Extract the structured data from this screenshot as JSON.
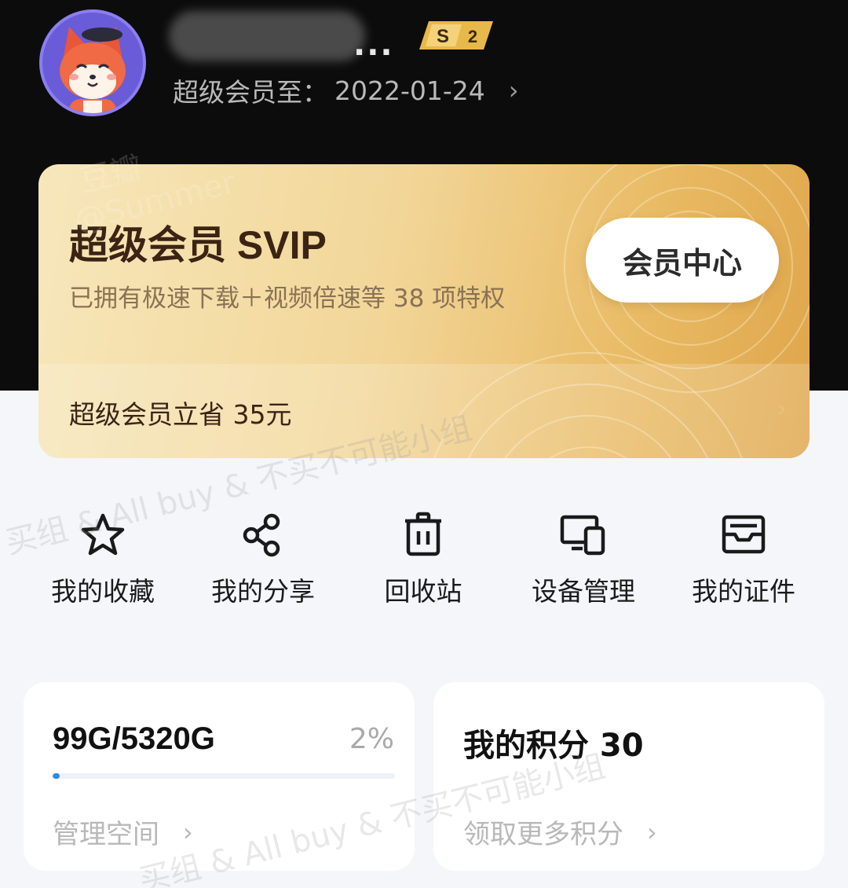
{
  "profile": {
    "username_suffix": "...",
    "level_badge_letter": "S",
    "level_badge_number": "2",
    "expiry_label": "超级会员至：",
    "expiry_date": "2022-01-24"
  },
  "svip_card": {
    "title": "超级会员 SVIP",
    "subtitle": "已拥有极速下载＋视频倍速等 38 项特权",
    "member_center_label": "会员中心",
    "savings_text": "超级会员立省 35元"
  },
  "quick_actions": [
    {
      "label": "我的收藏",
      "icon": "star-icon"
    },
    {
      "label": "我的分享",
      "icon": "share-icon"
    },
    {
      "label": "回收站",
      "icon": "trash-icon"
    },
    {
      "label": "设备管理",
      "icon": "devices-icon"
    },
    {
      "label": "我的证件",
      "icon": "id-card-icon"
    }
  ],
  "storage": {
    "usage": "99G/5320G",
    "percent_label": "2%",
    "percent_value": 2,
    "link_label": "管理空间"
  },
  "points": {
    "title": "我的积分 30",
    "link_label": "领取更多积分"
  },
  "watermark": {
    "brand": "豆瓣",
    "handle": "@Summer",
    "text_1": "买组 & All buy & 不买不可能小组"
  },
  "colors": {
    "accent_blue": "#2b8be8",
    "gold_start": "#f7e7bb",
    "gold_end": "#dfa64b",
    "header_bg": "#0c0c0c"
  }
}
